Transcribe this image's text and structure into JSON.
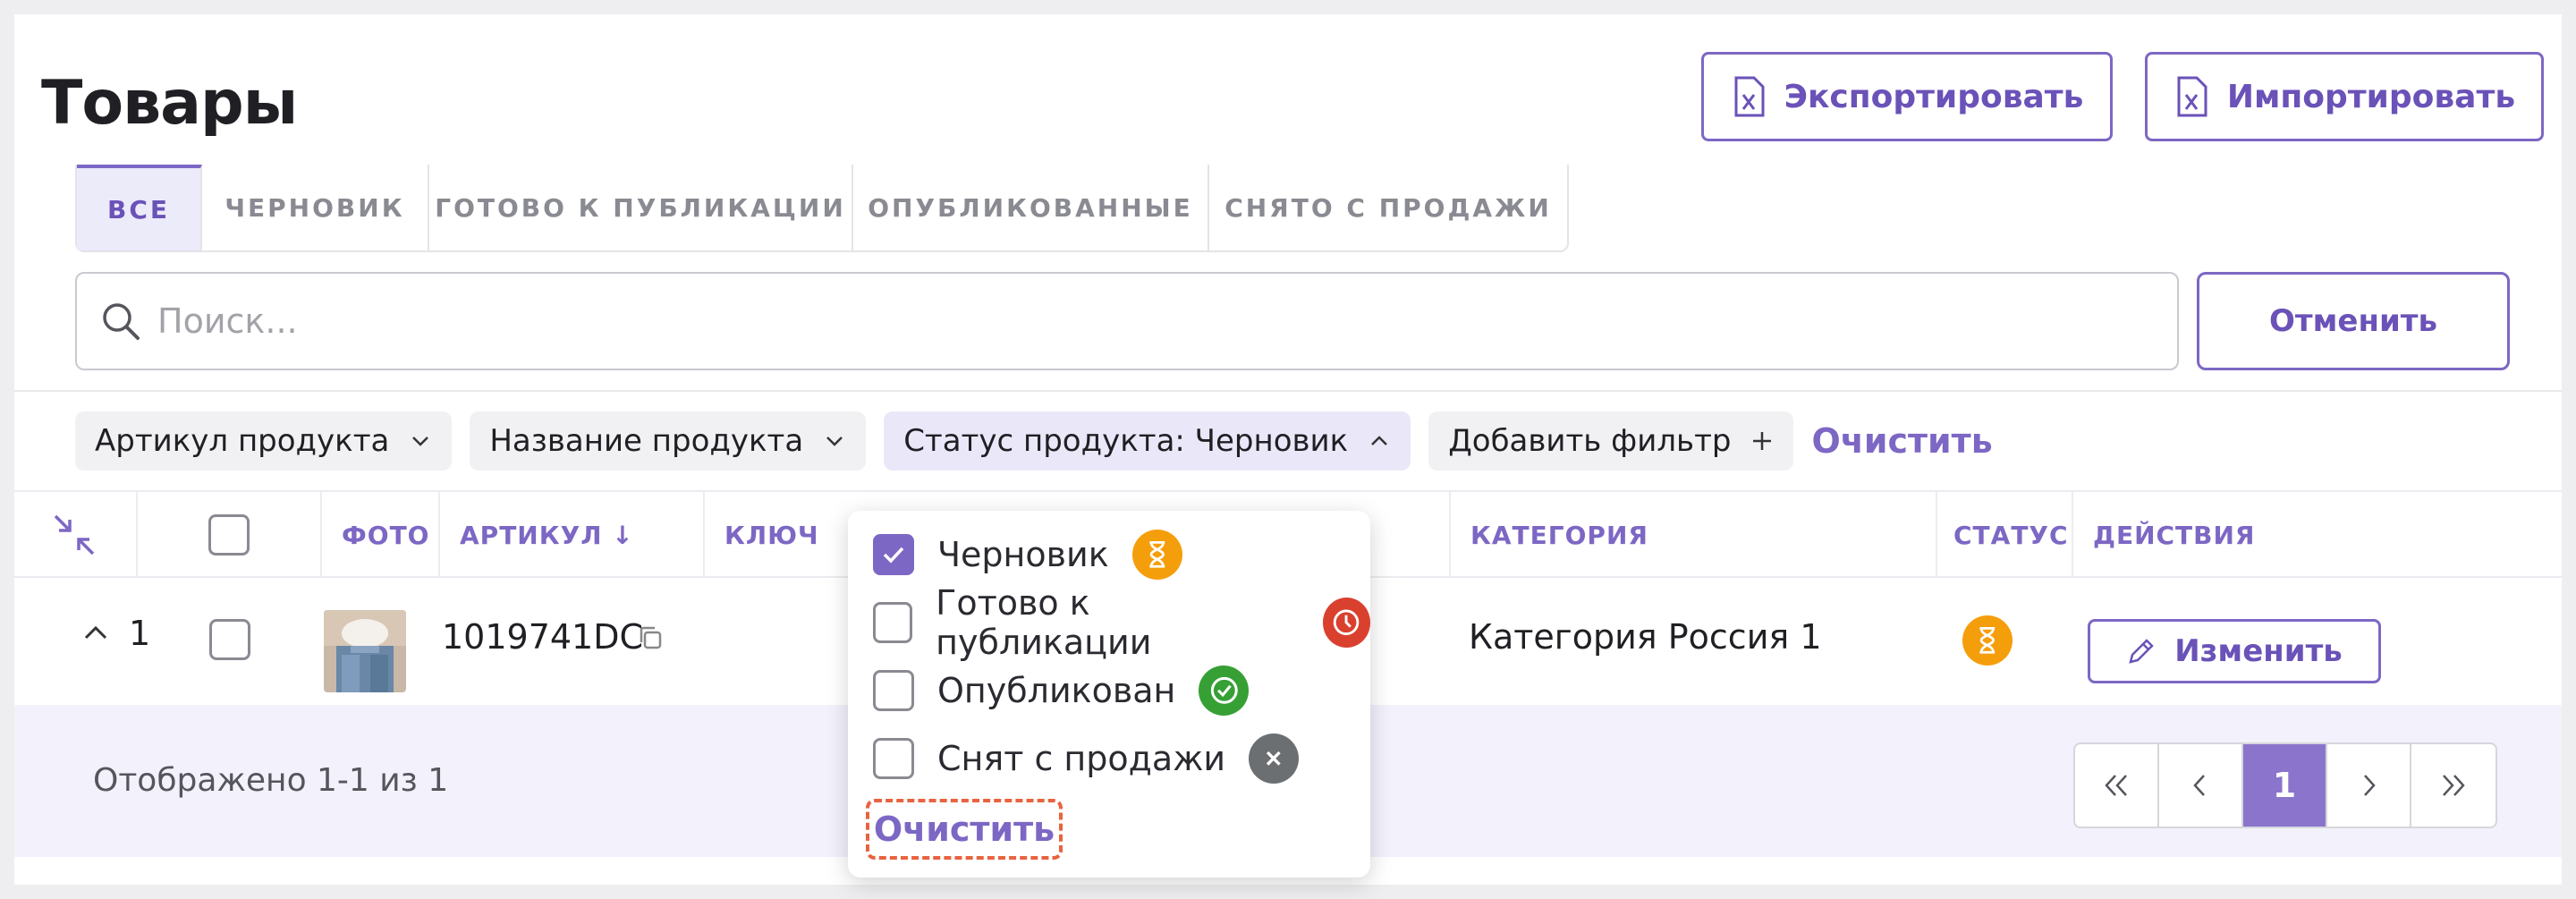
{
  "page": {
    "title": "Товары",
    "export_label": "Экспортировать",
    "import_label": "Импортировать"
  },
  "tabs": [
    {
      "label": "ВСЕ",
      "active": true
    },
    {
      "label": "ЧЕРНОВИК",
      "active": false
    },
    {
      "label": "ГОТОВО К ПУБЛИКАЦИИ",
      "active": false
    },
    {
      "label": "ОПУБЛИКОВАННЫЕ",
      "active": false
    },
    {
      "label": "СНЯТО С ПРОДАЖИ",
      "active": false
    }
  ],
  "search": {
    "placeholder": "Поиск...",
    "value": "",
    "cancel_label": "Отменить"
  },
  "filters": {
    "chips": [
      {
        "label": "Артикул продукта",
        "icon": "chevron-down-icon"
      },
      {
        "label": "Название продукта",
        "icon": "chevron-down-icon"
      },
      {
        "label": "Статус продукта: Черновик",
        "icon": "chevron-up-icon"
      },
      {
        "label": "Добавить фильтр",
        "icon": "plus-icon"
      }
    ],
    "clear_label": "Очистить"
  },
  "table": {
    "columns": {
      "photo": "ФОТО",
      "sku": "АРТИКУЛ ↓",
      "key": "КЛЮЧ",
      "category": "КАТЕГОРИЯ",
      "status": "СТАТУС",
      "actions": "ДЕЙСТВИЯ"
    },
    "rows": [
      {
        "index": "1",
        "sku": "1019741DC",
        "category": "Категория Россия 1",
        "status": "draft",
        "edit_label": "Изменить"
      }
    ]
  },
  "footer": {
    "shown_text": "Отображено 1-1 из 1",
    "current_page": "1"
  },
  "status_dropdown": {
    "options": [
      {
        "label": "Черновик",
        "checked": true,
        "color": "#f59e0b",
        "icon": "hourglass-icon"
      },
      {
        "label": "Готово к публикации",
        "checked": false,
        "color": "#d9412e",
        "icon": "clock-icon"
      },
      {
        "label": "Опубликован",
        "checked": false,
        "color": "#36a035",
        "icon": "check-circle-icon"
      },
      {
        "label": "Снят с продажи",
        "checked": false,
        "color": "#6b6f72",
        "icon": "x-icon"
      }
    ],
    "clear_label": "Очистить"
  },
  "colors": {
    "accent": "#7d67c4",
    "accent_dark": "#6a52b8",
    "footer_bg": "#f2f1fc",
    "clear_outline": "#e8633f"
  }
}
